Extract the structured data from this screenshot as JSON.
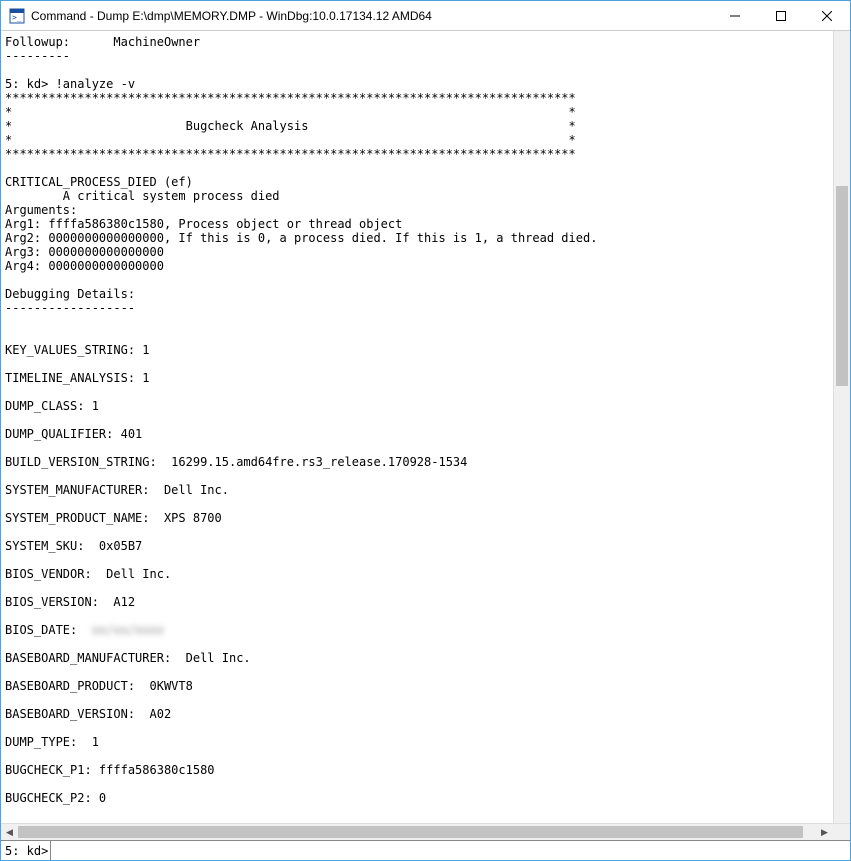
{
  "window": {
    "title": "Command - Dump E:\\dmp\\MEMORY.DMP - WinDbg:10.0.17134.12 AMD64"
  },
  "output": {
    "followup_label": "Followup:",
    "followup_value": "MachineOwner",
    "divider_short": "---------",
    "prompt_line": "5: kd> !analyze -v",
    "star_full": "*******************************************************************************",
    "star_edge": "*                                                                             *",
    "star_title": "*                        Bugcheck Analysis                                    *",
    "bugcheck_name": "CRITICAL_PROCESS_DIED (ef)",
    "bugcheck_desc": "        A critical system process died",
    "args_label": "Arguments:",
    "arg1": "Arg1: ffffa586380c1580, Process object or thread object",
    "arg2": "Arg2: 0000000000000000, If this is 0, a process died. If this is 1, a thread died.",
    "arg3": "Arg3: 0000000000000000",
    "arg4": "Arg4: 0000000000000000",
    "dbg_details": "Debugging Details:",
    "dbg_divider": "------------------",
    "key_values": "KEY_VALUES_STRING: 1",
    "timeline": "TIMELINE_ANALYSIS: 1",
    "dump_class": "DUMP_CLASS: 1",
    "dump_qualifier": "DUMP_QUALIFIER: 401",
    "build_version": "BUILD_VERSION_STRING:  16299.15.amd64fre.rs3_release.170928-1534",
    "sys_manufacturer": "SYSTEM_MANUFACTURER:  Dell Inc.",
    "sys_product": "SYSTEM_PRODUCT_NAME:  XPS 8700",
    "sys_sku": "SYSTEM_SKU:  0x05B7",
    "bios_vendor": "BIOS_VENDOR:  Dell Inc.",
    "bios_version": "BIOS_VERSION:  A12",
    "bios_date_label": "BIOS_DATE:  ",
    "bios_date_value": "xx/xx/xxxx",
    "baseboard_mfr": "BASEBOARD_MANUFACTURER:  Dell Inc.",
    "baseboard_product": "BASEBOARD_PRODUCT:  0KWVT8",
    "baseboard_version": "BASEBOARD_VERSION:  A02",
    "dump_type": "DUMP_TYPE:  1",
    "bugcheck_p1": "BUGCHECK_P1: ffffa586380c1580",
    "bugcheck_p2": "BUGCHECK_P2: 0"
  },
  "input": {
    "prompt": "5: kd>",
    "value": ""
  }
}
